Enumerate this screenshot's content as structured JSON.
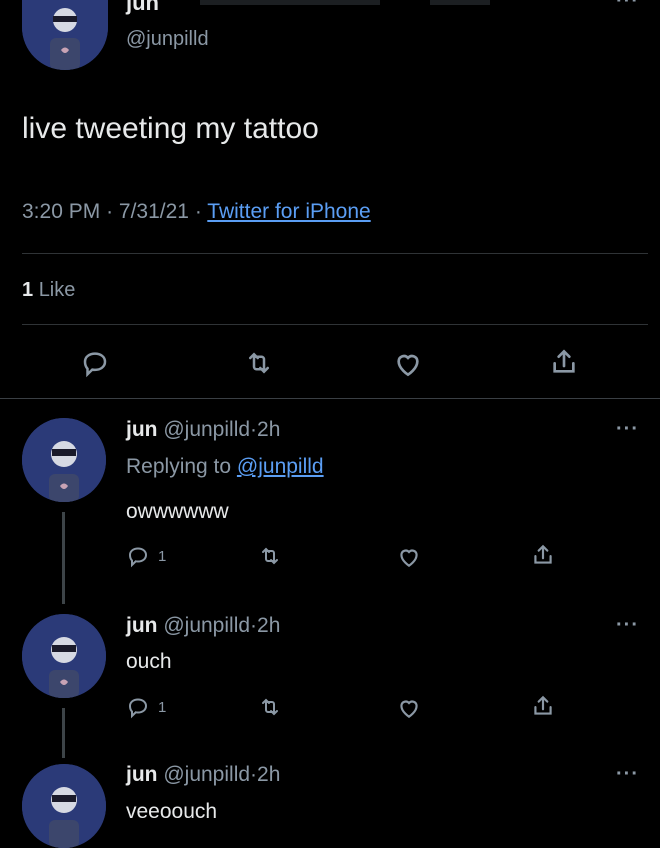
{
  "main_tweet": {
    "display_name": "jun",
    "handle": "@junpilld",
    "text": "live tweeting my tattoo",
    "time": "3:20 PM",
    "date": "7/31/21",
    "source": "Twitter for iPhone",
    "likes_count": "1",
    "likes_label": "Like"
  },
  "top_bar": {
    "more_label": "···"
  },
  "replies": [
    {
      "display_name": "jun",
      "handle": "@junpilld",
      "time": "2h",
      "replying_prefix": "Replying to",
      "replying_to": "@junpilld",
      "text": "owwwwww",
      "reply_count": "1"
    },
    {
      "display_name": "jun",
      "handle": "@junpilld",
      "time": "2h",
      "text": "ouch",
      "reply_count": "1"
    },
    {
      "display_name": "jun",
      "handle": "@junpilld",
      "time": "2h",
      "text": "veeoouch"
    }
  ],
  "separator": "·",
  "more_label": "···",
  "colors": {
    "background": "#000000",
    "text": "#e7e9ea",
    "muted": "#8b98a5",
    "link": "#5b9ef4",
    "avatar": "#2b3a78"
  },
  "icons": [
    "reply-icon",
    "retweet-icon",
    "like-icon",
    "share-icon",
    "more-icon",
    "avatar"
  ]
}
